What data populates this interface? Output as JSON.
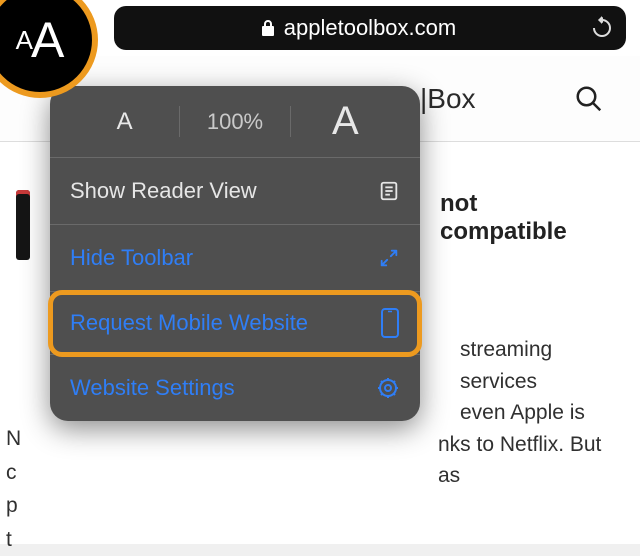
{
  "urlbar": {
    "hostname": "appletoolbox.com"
  },
  "page_header": {
    "brand_fragment": "|Box"
  },
  "popover": {
    "zoom_percent": "100%",
    "show_reader": "Show Reader View",
    "hide_toolbar": "Hide Toolbar",
    "request_mobile": "Request Mobile Website",
    "website_settings": "Website Settings"
  },
  "article": {
    "headline_fragment": "not compatible",
    "body_frag1": "streaming services",
    "body_frag2": "even Apple is",
    "body_frag3": "nks to Netflix. But as"
  }
}
